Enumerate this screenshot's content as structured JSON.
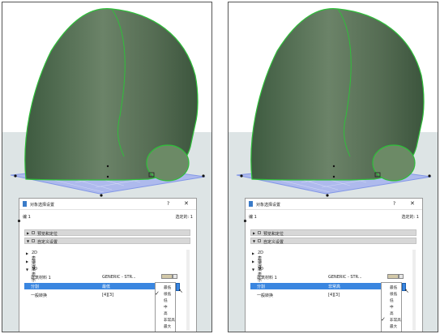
{
  "panels": [
    {
      "dialog": {
        "title": "对象选择设置",
        "help": "?",
        "close": "✕",
        "selection_label": "编 1",
        "selected_count": "选定的: 1",
        "groups": [
          "预览和定位",
          "自定义设置"
        ],
        "sections": [
          "2D表示法",
          "描述",
          "3D表示法"
        ],
        "properties": [
          {
            "key": "建筑材料 1",
            "value": "GENERIC - STR..."
          },
          {
            "key": "分割",
            "value": "最低"
          },
          {
            "key": "一般转换",
            "value": "[4][3]"
          }
        ],
        "options": [
          "最低",
          "很低",
          "低",
          "中",
          "高",
          "非常高",
          "最大"
        ],
        "checked": 1
      }
    },
    {
      "dialog": {
        "title": "对象选择设置",
        "help": "?",
        "close": "✕",
        "selection_label": "编 1",
        "selected_count": "选定的: 1",
        "groups": [
          "预览和定位",
          "自定义设置"
        ],
        "sections": [
          "2D表示法",
          "描述",
          "3D表示法"
        ],
        "properties": [
          {
            "key": "建筑材料 1",
            "value": "GENERIC - STR..."
          },
          {
            "key": "分割",
            "value": "非常高"
          },
          {
            "key": "一般转换",
            "value": "[4][3]"
          }
        ],
        "options": [
          "最低",
          "很低",
          "低",
          "中",
          "高",
          "非常高",
          "最大"
        ],
        "checked": 5
      }
    }
  ],
  "colors": {
    "model": "#5c735a",
    "model_outline": "#2fbf3a",
    "grid": "#7a90e8",
    "selection_blue": "#3a86e0"
  },
  "icons": [
    "dialog-icon",
    "help-icon",
    "close-icon",
    "expand-arrow-icon",
    "collapse-arrow-icon",
    "check-icon",
    "cursor-icon"
  ]
}
